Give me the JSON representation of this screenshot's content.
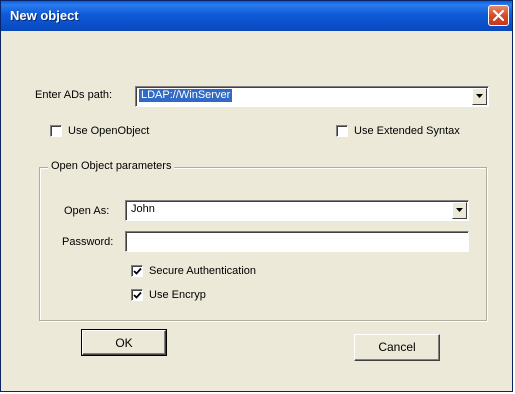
{
  "window": {
    "title": "New object"
  },
  "adspath": {
    "label": "Enter ADs path:",
    "value": "LDAP://WinServer"
  },
  "options": {
    "use_openobject": {
      "label": "Use OpenObject",
      "checked": false
    },
    "use_extended_syntax": {
      "label": "Use Extended Syntax",
      "checked": false
    }
  },
  "group": {
    "title": "Open Object parameters",
    "open_as_label": "Open As:",
    "open_as_value": "John",
    "password_label": "Password:",
    "password_value": "",
    "secure_auth": {
      "label": "Secure Authentication",
      "checked": true
    },
    "use_encrypt": {
      "label": "Use Encryp",
      "checked": true
    }
  },
  "buttons": {
    "ok": "OK",
    "cancel": "Cancel"
  },
  "colors": {
    "title_bar": "#0a4fc8",
    "dialog_bg": "#ece9d8",
    "selection": "#3169c6",
    "close": "#d94a2a"
  },
  "icons": {
    "close": "close-icon",
    "dropdown": "chevron-down-icon",
    "check": "checkmark-icon"
  }
}
